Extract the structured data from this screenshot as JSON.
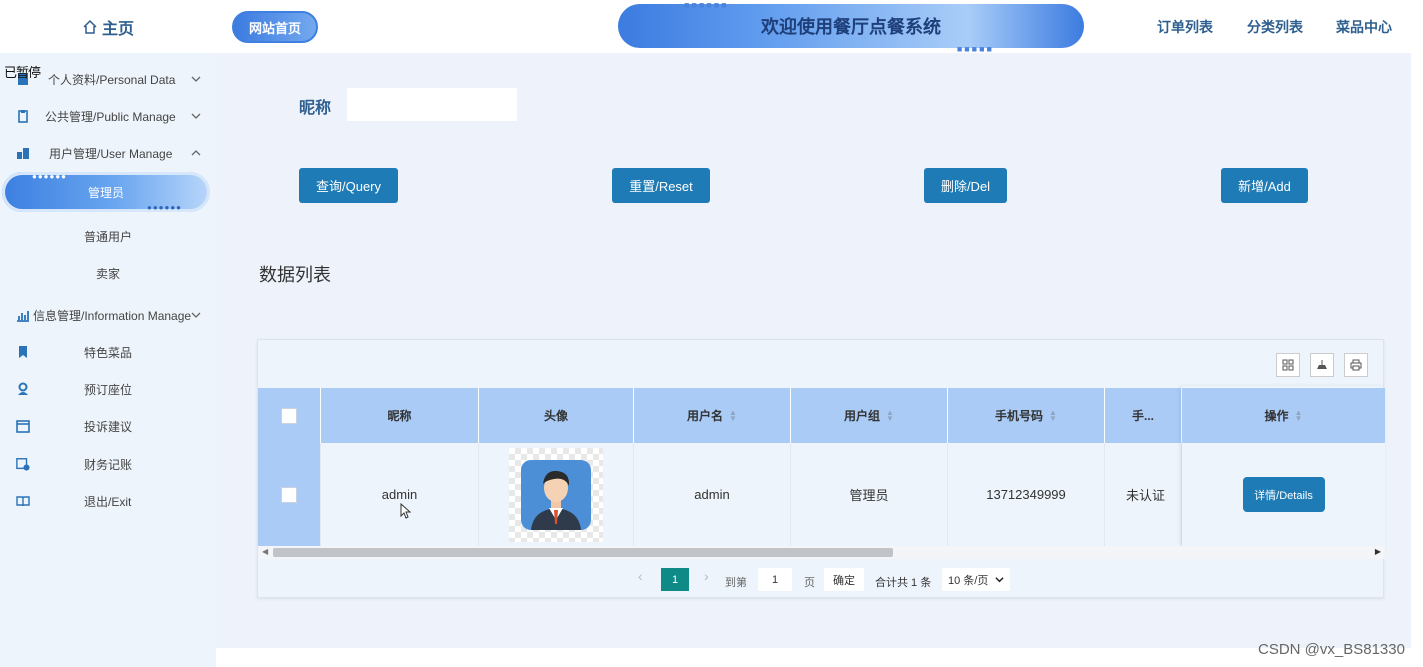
{
  "sidebar": {
    "home_label": "主页",
    "overlay_text": "已暂停",
    "menus": [
      {
        "label": "个人资料/Personal Data"
      },
      {
        "label": "公共管理/Public Manage"
      },
      {
        "label": "用户管理/User Manage"
      },
      {
        "label": "信息管理/Information Manage"
      }
    ],
    "user_sub": [
      "管理员",
      "普通用户",
      "卖家"
    ],
    "info_sub": [
      "特色菜品",
      "预订座位",
      "投诉建议",
      "财务记账",
      "退出/Exit"
    ]
  },
  "header": {
    "home_pill": "网站首页",
    "banner_title": "欢迎使用餐厅点餐系统",
    "nav": [
      "订单列表",
      "分类列表",
      "菜品中心"
    ]
  },
  "search": {
    "label": "昵称",
    "value": ""
  },
  "buttons": {
    "query": "查询/Query",
    "reset": "重置/Reset",
    "delete": "删除/Del",
    "add": "新增/Add"
  },
  "list_title": "数据列表",
  "table": {
    "columns": [
      "昵称",
      "头像",
      "用户名",
      "用户组",
      "手机号码",
      "手...",
      "操作"
    ],
    "rows": [
      {
        "nickname": "admin",
        "username": "admin",
        "group": "管理员",
        "phone": "13712349999",
        "cert": "未认证",
        "action": "详情/Details"
      }
    ]
  },
  "pagination": {
    "current_page": "1",
    "goto_prefix": "到第",
    "goto_value": "1",
    "goto_suffix": "页",
    "confirm": "确定",
    "total": "合计共 1 条",
    "page_size": "10 条/页"
  },
  "watermark": "CSDN @vx_BS81330",
  "colors": {
    "primary": "#1f7bb5",
    "header_bg": "#a9cbf6",
    "page_bg": "#eef3fb",
    "active_page": "#0f8a86"
  }
}
